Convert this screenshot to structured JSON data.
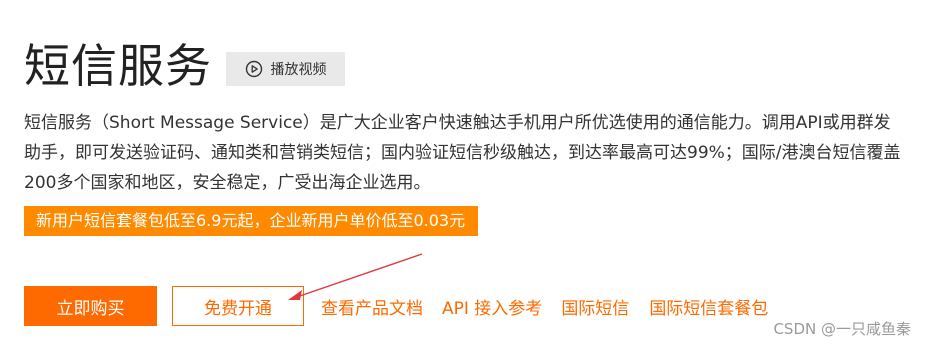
{
  "header": {
    "title": "短信服务",
    "video_button_label": "播放视频",
    "video_icon": "play-circle-icon"
  },
  "description": "短信服务（Short Message Service）是广大企业客户快速触达手机用户所优选使用的通信能力。调用API或用群发助手，即可发送验证码、通知类和营销类短信；国内验证短信秒级触达，到达率最高可达99%；国际/港澳台短信覆盖200多个国家和地区，安全稳定，广受出海企业选用。",
  "promo": {
    "text": "新用户短信套餐包低至6.9元起，企业新用户单价低至0.03元",
    "color": "#ff8a00"
  },
  "actions": {
    "buy_label": "立即购买",
    "free_label": "免费开通",
    "links": [
      "查看产品文档",
      "API 接入参考",
      "国际短信",
      "国际短信套餐包"
    ],
    "accent_color": "#ff6a00"
  },
  "annotation": {
    "arrow_color": "#e0383e"
  },
  "watermark": "CSDN @一只咸鱼秦"
}
